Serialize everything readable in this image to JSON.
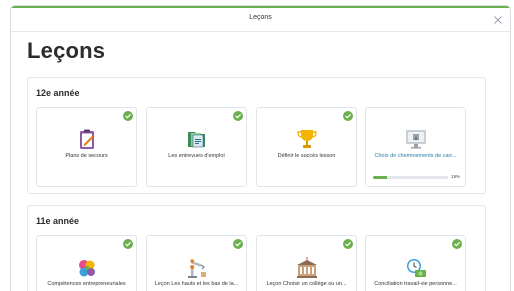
{
  "modal": {
    "title": "Leçons",
    "close_label": "×"
  },
  "page": {
    "title": "Leçons"
  },
  "colors": {
    "accent": "#6ab04c",
    "link": "#2a7da6"
  },
  "sections": [
    {
      "title": "12e année",
      "cards": [
        {
          "label": "Plans de secours",
          "icon": "clipboard-pencil-icon",
          "completed": true
        },
        {
          "label": "Les entrevues d'emploi",
          "icon": "folder-documents-icon",
          "completed": true
        },
        {
          "label": "Définir le succès lesson",
          "icon": "trophy-icon",
          "completed": true
        },
        {
          "label": "Choix de cheminements de carr...",
          "icon": "computer-monitor-icon",
          "completed": false,
          "progress": 19,
          "progress_label": "19%"
        }
      ]
    },
    {
      "title": "11e année",
      "cards": [
        {
          "label": "Compétences entrepreneuriales",
          "icon": "puzzle-pieces-icon",
          "completed": true
        },
        {
          "label": "Leçon Les hauts et les bas de la...",
          "icon": "robot-arm-icon",
          "completed": true
        },
        {
          "label": "Leçon Choisir un collège ou un...",
          "icon": "college-building-icon",
          "completed": true
        },
        {
          "label": "Conciliation travail-vie personne...",
          "icon": "clock-money-icon",
          "completed": true
        }
      ]
    }
  ]
}
